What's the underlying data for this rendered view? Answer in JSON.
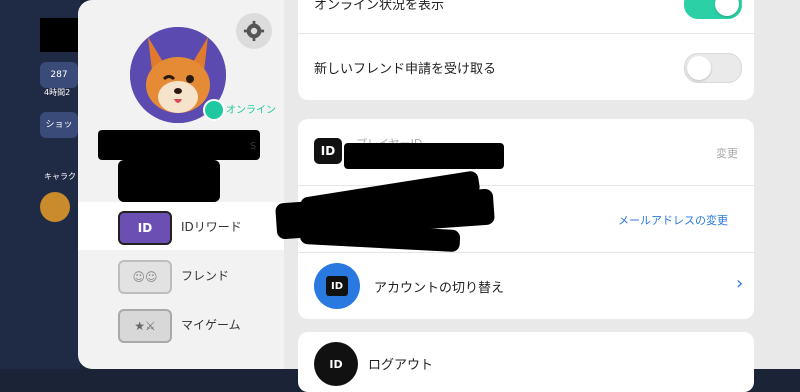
{
  "game_strip": {
    "trophy_count": "287",
    "event_timer": "4時間2",
    "shop_label": "ショッ",
    "character_label": "キャラクタ"
  },
  "profile": {
    "status": "オンライン",
    "name_suffix": "s"
  },
  "sidebar": {
    "items": [
      {
        "label": "IDリワード",
        "icon": "id-reward-icon",
        "active": true
      },
      {
        "label": "フレンド",
        "icon": "friends-icon",
        "active": false
      },
      {
        "label": "マイゲーム",
        "icon": "my-games-icon",
        "active": false
      }
    ]
  },
  "settings": {
    "online_status_label": "オンライン状況を表示",
    "online_status_on": true,
    "friend_requests_label": "新しいフレンド申請を受け取る",
    "friend_requests_on": false
  },
  "account": {
    "player_id_label": "プレイヤーID",
    "change_label": "変更",
    "email_change_link": "メールアドレスの変更",
    "switch_account_label": "アカウントの切り替え",
    "logout_label": "ログアウト"
  },
  "colors": {
    "accent_teal": "#2bd0a6",
    "link_blue": "#2a79e0"
  }
}
